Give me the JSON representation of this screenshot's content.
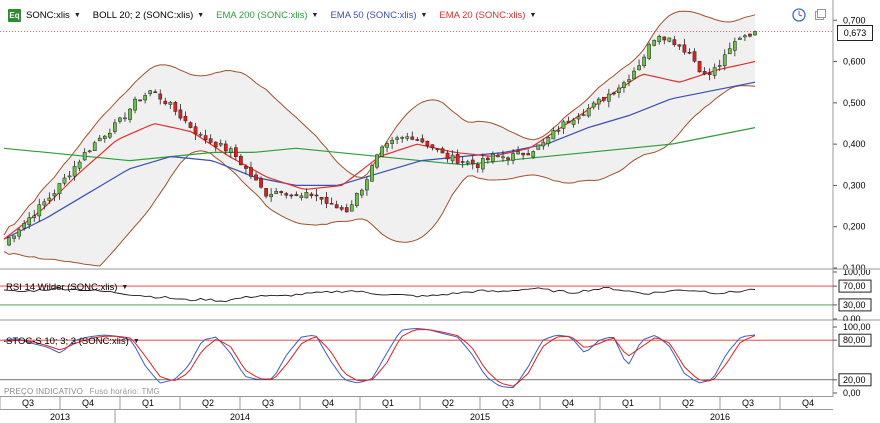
{
  "legend": {
    "icon_label": "Eq",
    "items": [
      {
        "label": "SONC:xlis",
        "color": "#000000"
      },
      {
        "label": "BOLL 20; 2 (SONC:xlis)",
        "color": "#000000"
      },
      {
        "label": "EMA 200 (SONC:xlis)",
        "color": "#2e9e3a"
      },
      {
        "label": "EMA 50 (SONC:xlis)",
        "color": "#3c4fa8"
      },
      {
        "label": "EMA 20 (SONC:xlis)",
        "color": "#d83030"
      }
    ]
  },
  "rsi_legend": "RSI 14 Wilder (SONC:xlis)",
  "stoch_legend": "STOC-S 10; 3; 3 (SONC:xlis)",
  "footer": {
    "label": "PREÇO INDICATIVO",
    "timezone": "Fuso horário: TMG"
  },
  "current_price_label": "0,673",
  "colors": {
    "up": "#6cc04a",
    "down": "#e02020",
    "ema20": "#e03030",
    "ema50": "#3a4fb0",
    "ema200": "#2e9e3a",
    "boll": "#a0522d",
    "boll_fill": "#f0f0f0",
    "rsi_line": "#1a1a1a",
    "stoch_k": "#3c5fc0",
    "stoch_d": "#e02020",
    "ref_line": "#e03030",
    "ref_green": "#2e9e3a"
  },
  "chart_data": [
    {
      "type": "candlestick",
      "series_name": "SONC:xlis",
      "ylim": [
        0.1,
        0.72
      ],
      "y_ticks": [
        "0,100",
        "0,200",
        "0,300",
        "0,400",
        "0,500",
        "0,600",
        "0,700"
      ],
      "x_quarters": [
        "Q3",
        "Q4",
        "Q1",
        "Q2",
        "Q3",
        "Q4",
        "Q1",
        "Q2",
        "Q3",
        "Q4",
        "Q1",
        "Q2",
        "Q3",
        "Q4"
      ],
      "x_years": [
        "2013",
        "2014",
        "2015",
        "2016"
      ],
      "last_price": 0.673,
      "close_anchors": [
        0.16,
        0.2,
        0.24,
        0.28,
        0.33,
        0.38,
        0.42,
        0.45,
        0.5,
        0.53,
        0.5,
        0.46,
        0.42,
        0.4,
        0.38,
        0.33,
        0.28,
        0.29,
        0.27,
        0.28,
        0.25,
        0.24,
        0.3,
        0.38,
        0.41,
        0.42,
        0.4,
        0.37,
        0.36,
        0.35,
        0.37,
        0.37,
        0.38,
        0.4,
        0.44,
        0.47,
        0.49,
        0.52,
        0.55,
        0.6,
        0.67,
        0.65,
        0.62,
        0.56,
        0.6,
        0.66,
        0.673
      ],
      "ema200_anchors": [
        0.39,
        0.38,
        0.37,
        0.36,
        0.37,
        0.38,
        0.38,
        0.39,
        0.38,
        0.37,
        0.36,
        0.35,
        0.36,
        0.37,
        0.38,
        0.39,
        0.4,
        0.42,
        0.44
      ],
      "ema50_anchors": [
        0.17,
        0.22,
        0.28,
        0.34,
        0.37,
        0.36,
        0.32,
        0.3,
        0.3,
        0.33,
        0.36,
        0.37,
        0.38,
        0.4,
        0.44,
        0.47,
        0.51,
        0.53,
        0.55
      ],
      "ema20_anchors": [
        0.17,
        0.24,
        0.33,
        0.41,
        0.45,
        0.43,
        0.37,
        0.32,
        0.29,
        0.3,
        0.37,
        0.4,
        0.38,
        0.37,
        0.39,
        0.45,
        0.51,
        0.57,
        0.55,
        0.58,
        0.6
      ]
    },
    {
      "type": "line",
      "series_name": "RSI 14 Wilder (SONC:xlis)",
      "ylim": [
        0,
        100
      ],
      "y_ticks": [
        "100,00",
        "70,00",
        "30,00",
        "0,00"
      ],
      "reference_lines": [
        70,
        30
      ],
      "values": [
        60,
        58,
        62,
        65,
        63,
        60,
        57,
        52,
        48,
        45,
        40,
        42,
        38,
        45,
        50,
        48,
        52,
        55,
        58,
        60,
        55,
        52,
        50,
        48,
        52,
        56,
        60,
        58,
        62,
        65,
        60,
        56,
        62,
        66,
        60,
        54,
        58,
        62,
        60,
        55,
        58,
        64
      ]
    },
    {
      "type": "line",
      "series_name": "STOC-S 10; 3; 3 (SONC:xlis)",
      "ylim": [
        0,
        100
      ],
      "y_ticks": [
        "100,00",
        "80,00",
        "20,00",
        "0,00"
      ],
      "reference_lines": [
        80,
        20
      ],
      "k_values": [
        80,
        82,
        75,
        70,
        60,
        80,
        85,
        88,
        86,
        80,
        40,
        15,
        20,
        40,
        80,
        85,
        60,
        25,
        20,
        22,
        60,
        85,
        88,
        50,
        20,
        15,
        22,
        60,
        95,
        98,
        96,
        90,
        85,
        60,
        25,
        10,
        8,
        40,
        80,
        88,
        85,
        60,
        80,
        86,
        40,
        80,
        88,
        70,
        30,
        15,
        20,
        60,
        85,
        88
      ],
      "d_values": [
        78,
        80,
        78,
        72,
        65,
        75,
        82,
        86,
        86,
        83,
        55,
        25,
        18,
        30,
        65,
        82,
        70,
        35,
        22,
        20,
        45,
        75,
        86,
        65,
        30,
        18,
        20,
        45,
        85,
        96,
        96,
        92,
        87,
        70,
        35,
        15,
        10,
        30,
        70,
        85,
        86,
        68,
        75,
        84,
        55,
        70,
        85,
        75,
        40,
        20,
        18,
        45,
        78,
        87
      ]
    }
  ]
}
